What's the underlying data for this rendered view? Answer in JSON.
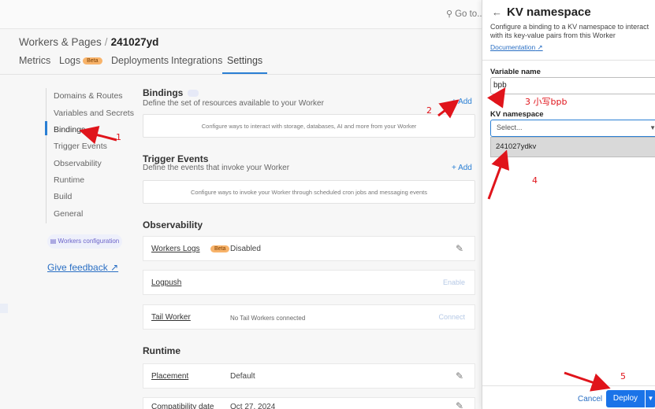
{
  "topbar": {
    "goto": "Go to..."
  },
  "breadcrumb": {
    "parent": "Workers & Pages",
    "current": "241027yd"
  },
  "tabs": [
    {
      "label": "Metrics"
    },
    {
      "label": "Logs",
      "badge": "Beta"
    },
    {
      "label": "Deployments"
    },
    {
      "label": "Integrations"
    },
    {
      "label": "Settings"
    }
  ],
  "sidebar": {
    "items": [
      "Domains & Routes",
      "Variables and Secrets",
      "Bindings",
      "Trigger Events",
      "Observability",
      "Runtime",
      "Build",
      "General"
    ],
    "workers_config": "Workers configuration",
    "feedback": "Give feedback"
  },
  "bindings": {
    "title": "Bindings",
    "subtitle": "Define the set of resources available to your Worker",
    "add": "+ Add",
    "empty": "Configure ways to interact with storage, databases, AI and more from your Worker"
  },
  "trigger": {
    "title": "Trigger Events",
    "subtitle": "Define the events that invoke your Worker",
    "add": "+ Add",
    "empty": "Configure ways to invoke your Worker through scheduled cron jobs and messaging events"
  },
  "observability": {
    "title": "Observability",
    "rows": [
      {
        "key": "Workers Logs",
        "badge": "Beta",
        "value": "Disabled"
      },
      {
        "key": "Logpush",
        "action": "Enable"
      },
      {
        "key": "Tail Worker",
        "value": "No Tail Workers connected",
        "action": "Connect"
      }
    ]
  },
  "runtime": {
    "title": "Runtime",
    "rows": [
      {
        "key": "Placement",
        "value": "Default"
      },
      {
        "key": "Compatibility date",
        "value": "Oct 27, 2024"
      }
    ]
  },
  "panel": {
    "title": "KV namespace",
    "description": "Configure a binding to a KV namespace to interact with its key-value pairs from this Worker",
    "doc_link": "Documentation",
    "variable_label": "Variable name",
    "variable_value": "bpb",
    "kv_label": "KV namespace",
    "select_placeholder": "Select...",
    "option": "241027ydkv",
    "cancel": "Cancel",
    "deploy": "Deploy"
  },
  "annotations": {
    "a1": "1",
    "a2": "2",
    "a3": "3 小写bpb",
    "a4": "4",
    "a5": "5",
    "color": "#e0141b"
  }
}
